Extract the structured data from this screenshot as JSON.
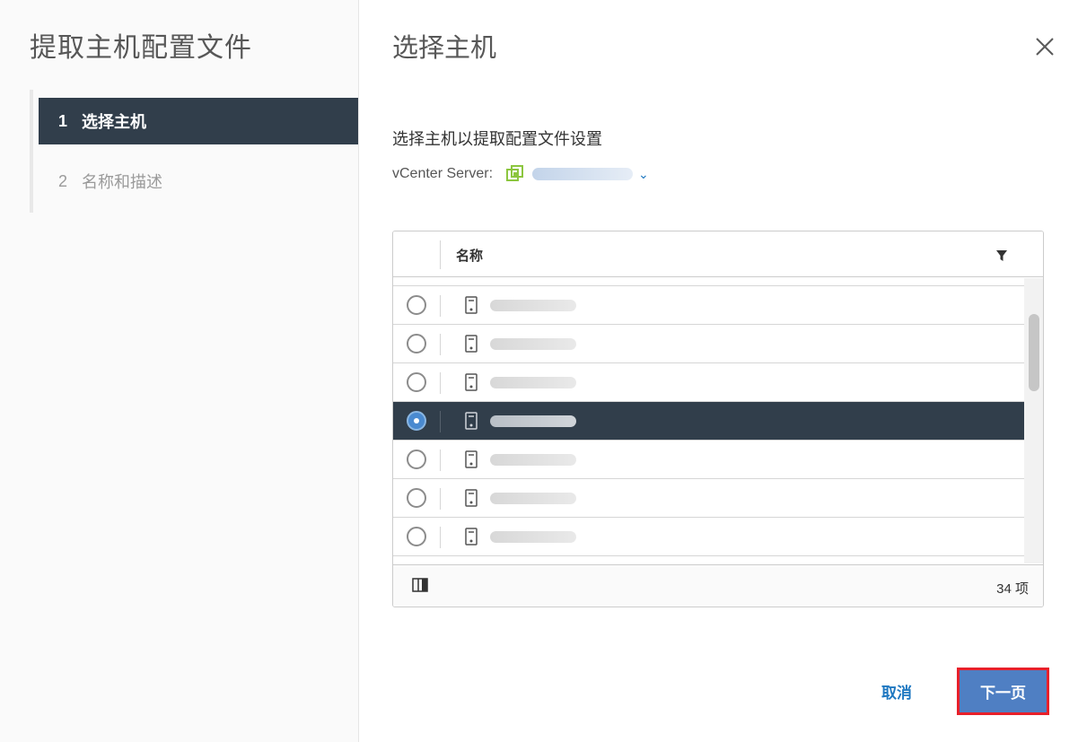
{
  "wizard": {
    "title": "提取主机配置文件",
    "steps": [
      {
        "number": "1",
        "label": "选择主机",
        "state": "active"
      },
      {
        "number": "2",
        "label": "名称和描述",
        "state": "inactive"
      }
    ]
  },
  "page": {
    "title": "选择主机",
    "subtitle": "选择主机以提取配置文件设置",
    "vcenter_label": "vCenter Server:"
  },
  "grid": {
    "column_name": "名称",
    "rows": [
      {
        "selected": false
      },
      {
        "selected": false
      },
      {
        "selected": false
      },
      {
        "selected": true
      },
      {
        "selected": false
      },
      {
        "selected": false
      },
      {
        "selected": false
      }
    ],
    "item_count": "34 项"
  },
  "footer": {
    "cancel_label": "取消",
    "next_label": "下一页"
  },
  "colors": {
    "active_step_bg": "#313e4b",
    "primary_button": "#4f7fc3",
    "highlight_border": "#e8202a",
    "link": "#1f78c1"
  },
  "icons": {
    "close": "close-icon",
    "vcenter": "vcenter-icon",
    "filter": "filter-icon",
    "host": "host-server-icon",
    "columns": "column-toggle-icon"
  }
}
